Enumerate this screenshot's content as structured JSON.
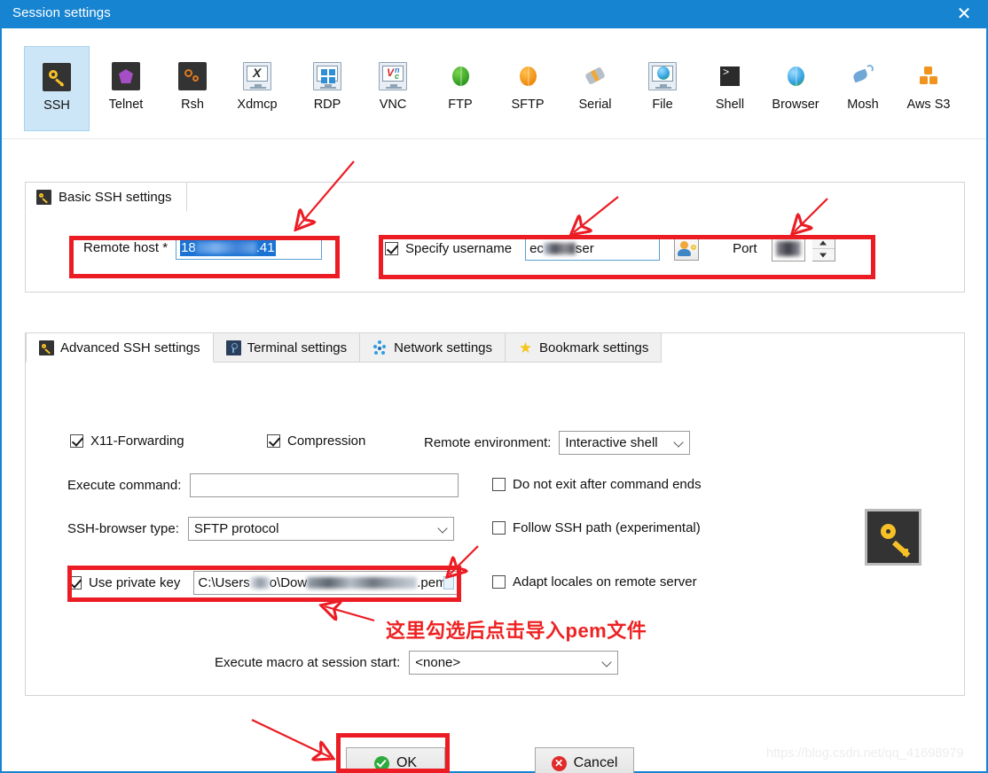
{
  "window": {
    "title": "Session settings",
    "close_icon": "close-icon"
  },
  "protocols": [
    {
      "label": "SSH",
      "icon": "key-icon",
      "selected": true
    },
    {
      "label": "Telnet",
      "icon": "gem-icon",
      "selected": false
    },
    {
      "label": "Rsh",
      "icon": "gears-icon",
      "selected": false
    },
    {
      "label": "Xdmcp",
      "icon": "x-monitor-icon",
      "selected": false
    },
    {
      "label": "RDP",
      "icon": "windows-monitor-icon",
      "selected": false
    },
    {
      "label": "VNC",
      "icon": "vnc-monitor-icon",
      "selected": false
    },
    {
      "label": "FTP",
      "icon": "green-globe-icon",
      "selected": false
    },
    {
      "label": "SFTP",
      "icon": "orange-globe-icon",
      "selected": false
    },
    {
      "label": "Serial",
      "icon": "serial-plug-icon",
      "selected": false
    },
    {
      "label": "File",
      "icon": "file-monitor-icon",
      "selected": false
    },
    {
      "label": "Shell",
      "icon": "shell-prompt-icon",
      "selected": false
    },
    {
      "label": "Browser",
      "icon": "blue-globe-icon",
      "selected": false
    },
    {
      "label": "Mosh",
      "icon": "satellite-dish-icon",
      "selected": false
    },
    {
      "label": "Aws S3",
      "icon": "aws-cubes-icon",
      "selected": false
    }
  ],
  "basic": {
    "group_title": "Basic SSH settings",
    "group_icon": "key-icon",
    "remote_host_label": "Remote host *",
    "remote_host_value_prefix": "18",
    "remote_host_value_suffix": ".41",
    "remote_host_selected": true,
    "specify_username_label": "Specify username",
    "specify_username_checked": true,
    "username_value_prefix": "ec",
    "username_value_suffix": "ser",
    "user_button_icon": "user-key-icon",
    "port_label": "Port",
    "port_value_blurred": true
  },
  "tabs": [
    {
      "label": "Advanced SSH settings",
      "icon": "key-icon",
      "active": true
    },
    {
      "label": "Terminal settings",
      "icon": "terminal-icon",
      "active": false
    },
    {
      "label": "Network settings",
      "icon": "network-icon",
      "active": false
    },
    {
      "label": "Bookmark settings",
      "icon": "star-icon",
      "active": false
    }
  ],
  "advanced": {
    "x11_label": "X11-Forwarding",
    "x11_checked": true,
    "compression_label": "Compression",
    "compression_checked": true,
    "remote_env_label": "Remote environment:",
    "remote_env_value": "Interactive shell",
    "execute_command_label": "Execute command:",
    "execute_command_value": "",
    "do_not_exit_label": "Do not exit after command ends",
    "do_not_exit_checked": false,
    "ssh_browser_label": "SSH-browser type:",
    "ssh_browser_value": "SFTP protocol",
    "follow_ssh_label": "Follow SSH path (experimental)",
    "follow_ssh_checked": false,
    "use_private_key_label": "Use private key",
    "use_private_key_checked": true,
    "private_key_prefix": "C:\\Users",
    "private_key_mid": "o\\Dow",
    "private_key_suffix": ".pem",
    "browse_icon": "file-browse-icon",
    "adapt_locales_label": "Adapt locales on remote server",
    "adapt_locales_checked": false,
    "macro_label": "Execute macro at session start:",
    "macro_value": "<none>",
    "key_picture_icon": "large-key-icon"
  },
  "buttons": {
    "ok_label": "OK",
    "ok_icon": "green-check-icon",
    "cancel_label": "Cancel",
    "cancel_icon": "red-x-icon"
  },
  "annotations": {
    "note_text": "这里勾选后点击导入pem文件",
    "color": "#ec1c24"
  },
  "watermark": {
    "text": "https://blog.csdn.net/qq_41698979"
  }
}
